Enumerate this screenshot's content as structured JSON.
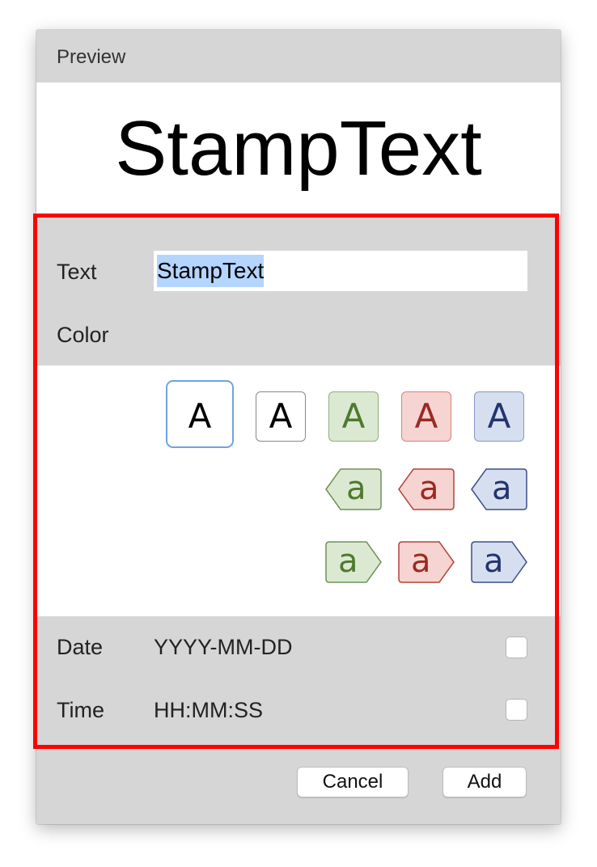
{
  "preview": {
    "header_label": "Preview",
    "stamp_text": "StampText"
  },
  "form": {
    "text_label": "Text",
    "text_value": "StampText",
    "color_label": "Color",
    "date_label": "Date",
    "date_format": "YYYY-MM-DD",
    "date_checked": false,
    "time_label": "Time",
    "time_format": "HH:MM:SS",
    "time_checked": false
  },
  "color_swatches": {
    "solid": [
      {
        "glyph": "A",
        "icon": "plain-a-icon",
        "fill": "#ffffff",
        "stroke": "#ffffff",
        "text": "#000000",
        "selected": true
      },
      {
        "glyph": "A",
        "icon": "outlined-a-icon",
        "fill": "#ffffff",
        "stroke": "#888888",
        "text": "#000000",
        "selected": false
      },
      {
        "glyph": "A",
        "icon": "green-a-icon",
        "fill": "#dce9d2",
        "stroke": "#8fae7c",
        "text": "#4e7a2e",
        "selected": false
      },
      {
        "glyph": "A",
        "icon": "red-a-icon",
        "fill": "#f6d4d1",
        "stroke": "#d7827b",
        "text": "#9b2a22",
        "selected": false
      },
      {
        "glyph": "A",
        "icon": "blue-a-icon",
        "fill": "#d6dff0",
        "stroke": "#8597c4",
        "text": "#23346e",
        "selected": false
      }
    ],
    "left_tags": [
      {
        "glyph": "a",
        "icon": "green-left-tag-icon",
        "fill": "#dce9d2",
        "stroke": "#6f9258",
        "text": "#4e7a2e"
      },
      {
        "glyph": "a",
        "icon": "red-left-tag-icon",
        "fill": "#f6d4d1",
        "stroke": "#b2443c",
        "text": "#9b2a22"
      },
      {
        "glyph": "a",
        "icon": "blue-left-tag-icon",
        "fill": "#d6dff0",
        "stroke": "#3d4f88",
        "text": "#23346e"
      }
    ],
    "right_tags": [
      {
        "glyph": "a",
        "icon": "green-right-tag-icon",
        "fill": "#dce9d2",
        "stroke": "#6f9258",
        "text": "#4e7a2e"
      },
      {
        "glyph": "a",
        "icon": "red-right-tag-icon",
        "fill": "#f6d4d1",
        "stroke": "#b2443c",
        "text": "#9b2a22"
      },
      {
        "glyph": "a",
        "icon": "blue-right-tag-icon",
        "fill": "#d6dff0",
        "stroke": "#3d4f88",
        "text": "#23346e"
      }
    ]
  },
  "buttons": {
    "cancel_label": "Cancel",
    "add_label": "Add"
  },
  "colors": {
    "highlight": "#ff0000",
    "panel_bg": "#d6d6d6",
    "selection": "#b4d5fe",
    "focus_ring": "#6fa3e0"
  }
}
